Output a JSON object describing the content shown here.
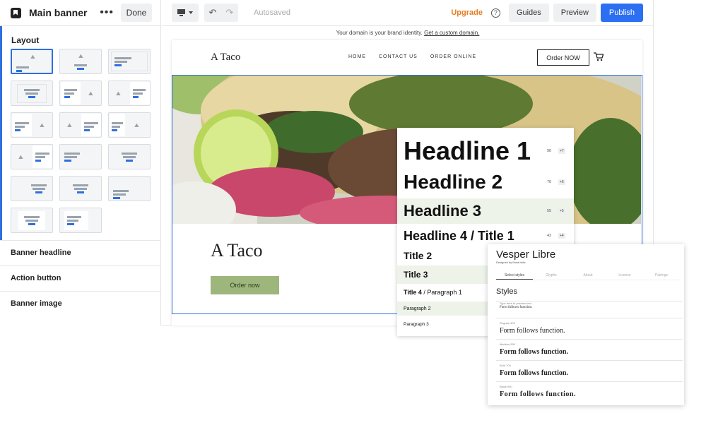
{
  "panel": {
    "title": "Main banner",
    "more": "•••",
    "done": "Done",
    "layout_label": "Layout",
    "sections": [
      "Banner headline",
      "Action button",
      "Banner image"
    ]
  },
  "toolbar": {
    "autosaved": "Autosaved",
    "upgrade": "Upgrade",
    "help": "?",
    "guides": "Guides",
    "preview": "Preview",
    "publish": "Publish"
  },
  "domain_notice": {
    "text": "Your domain is your brand identity. ",
    "link": "Get a custom domain."
  },
  "site": {
    "brand": "A Taco",
    "nav": [
      "HOME",
      "CONTACT US",
      "ORDER ONLINE"
    ],
    "cta": "Order NOW",
    "hero_headline": "A Taco",
    "hero_button": "Order now"
  },
  "typography": [
    {
      "label": "Headline 1",
      "size": "90",
      "step": "+7"
    },
    {
      "label": "Headline 2",
      "size": "70",
      "step": "+6"
    },
    {
      "label": "Headline 3",
      "size": "55",
      "step": "+5"
    },
    {
      "label": "Headline 4 / Title 1",
      "size": "43",
      "step": "+4"
    },
    {
      "label": "Title 2"
    },
    {
      "label": "Title 3"
    },
    {
      "label": "Title 4",
      "suffix": " / Paragraph 1"
    },
    {
      "label": "Paragraph 2"
    },
    {
      "label": "Paragraph 3"
    }
  ],
  "font_card": {
    "name": "Vesper Libre",
    "designer": "Designed by Mota Italic",
    "tabs": [
      "Select styles",
      "Glyphs",
      "About",
      "License",
      "Pairings"
    ],
    "styles_heading": "Styles",
    "styles": [
      {
        "label": "Type here to preview text",
        "sample": "Form follows function."
      },
      {
        "label": "Regular 400",
        "sample": "Form follows function."
      },
      {
        "label": "Medium 500",
        "sample": "Form follows function."
      },
      {
        "label": "Bold 700",
        "sample": "Form follows function."
      },
      {
        "label": "Black 900",
        "sample": "Form follows function."
      }
    ]
  }
}
